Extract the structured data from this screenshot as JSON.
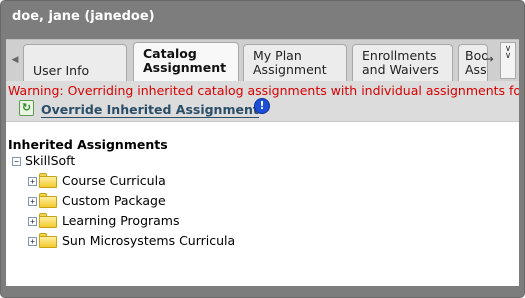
{
  "window": {
    "title": "doe, jane (janedoe)"
  },
  "tabs": [
    {
      "line1": "",
      "line2": "User Info"
    },
    {
      "line1": "Catalog",
      "line2": "Assignment"
    },
    {
      "line1": "My Plan",
      "line2": "Assignment"
    },
    {
      "line1": "Enrollments",
      "line2": "and Waivers"
    },
    {
      "line1": "Boo",
      "line2": "Ass"
    }
  ],
  "icons": {
    "scroll_left": "triangle-left",
    "scroll_right": "arrow-right",
    "tab_menu": "double-chevron-down",
    "override": "green-refresh-arrows",
    "info": "blue-exclamation-circle",
    "folder": "yellow-folder"
  },
  "warning": "Warning: Overriding inherited catalog assignments with individual assignments fo",
  "override_link": "Override Inherited Assignment",
  "tree": {
    "heading": "Inherited Assignments",
    "root": {
      "toggle": "−",
      "label": "SkillSoft"
    },
    "items": [
      {
        "toggle": "+",
        "label": "Course Curricula"
      },
      {
        "toggle": "+",
        "label": "Custom Package"
      },
      {
        "toggle": "+",
        "label": "Learning Programs"
      },
      {
        "toggle": "+",
        "label": "Sun Microsystems Curricula"
      }
    ]
  },
  "colors": {
    "window_bg": "#7d7d7d",
    "warning_text": "#d90000",
    "link_text": "#2b4e68",
    "info_blue": "#1e4fd8",
    "folder_yellow": "#f5d34a"
  }
}
